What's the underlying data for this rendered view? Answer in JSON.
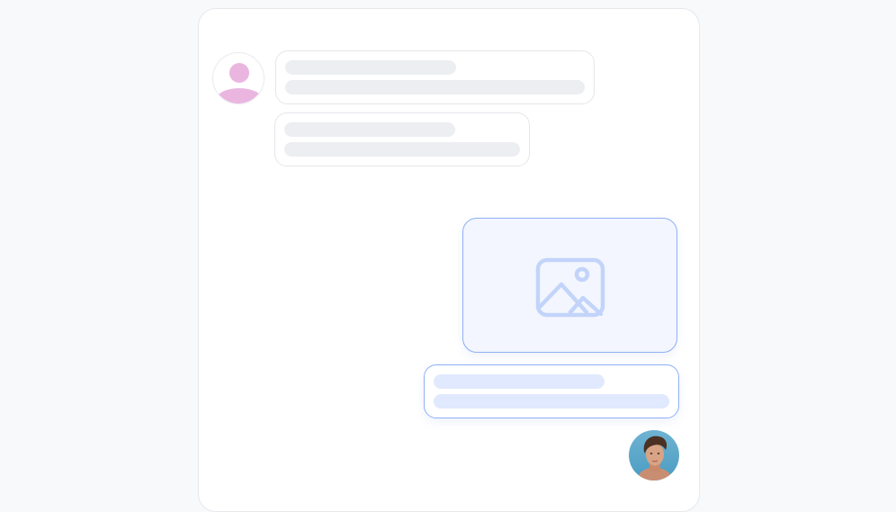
{
  "conversation": {
    "incoming": {
      "avatar_icon": "person-icon",
      "avatar_color": "#eab6e0"
    },
    "outgoing": {
      "image_icon": "image-icon",
      "accent_color": "#8fb0f5",
      "user_avatar": "user-avatar-photo"
    }
  }
}
